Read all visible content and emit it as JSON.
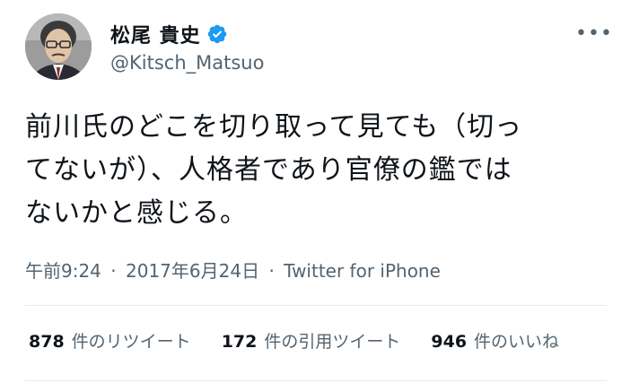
{
  "author": {
    "display_name": "松尾 貴史",
    "handle": "@Kitsch_Matsuo",
    "verified": true,
    "verified_icon": "verified-badge-icon",
    "verified_color": "#1d9bf0"
  },
  "menu": {
    "more_icon": "more-horizontal-icon",
    "more_glyph": "•••"
  },
  "tweet": {
    "text": "前川氏のどこを切り取って見ても（切っ\nてないが）、人格者であり官僚の鑑では\nないかと感じる。"
  },
  "meta": {
    "time": "午前9:24",
    "dot1": "·",
    "date": "2017年6月24日",
    "dot2": "·",
    "source": "Twitter for iPhone"
  },
  "stats": {
    "retweets": {
      "count": "878",
      "label": "件のリツイート"
    },
    "quotes": {
      "count": "172",
      "label": "件の引用ツイート"
    },
    "likes": {
      "count": "946",
      "label": "件のいいね"
    }
  },
  "colors": {
    "text_primary": "#0f1419",
    "text_secondary": "#536471",
    "divider": "#e6ecf0"
  }
}
